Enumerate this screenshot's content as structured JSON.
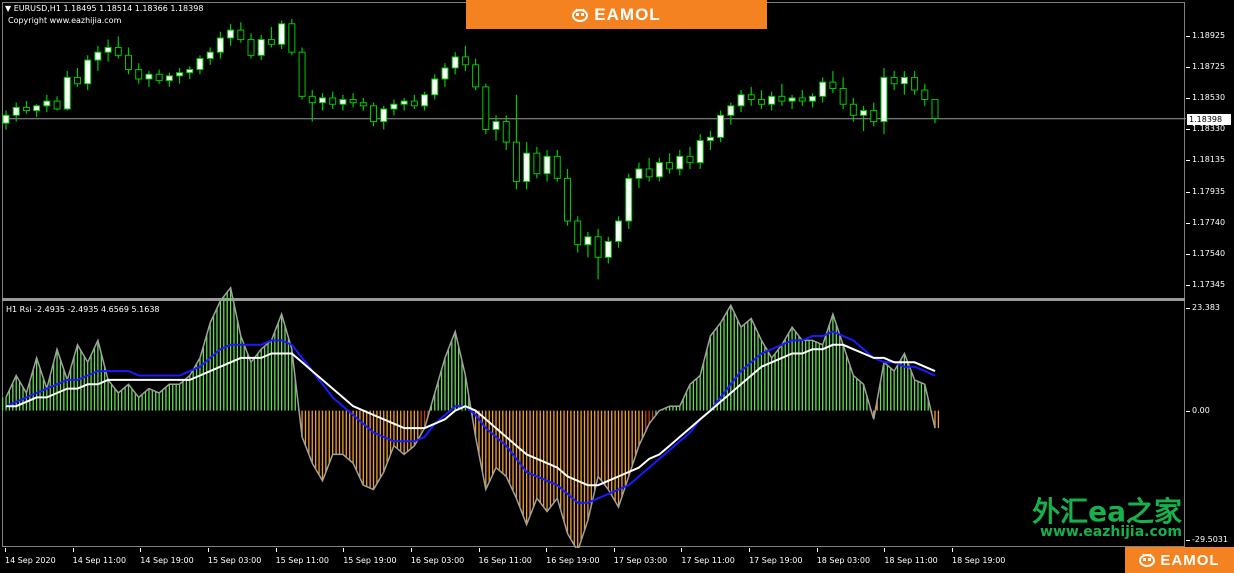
{
  "chart_window": {
    "symbol_header": "EURUSD,H1  1.18495 1.18514 1.18366 1.18398",
    "copyright": "Copyright www.eazhijia.com",
    "indicator_header": "H1 Rsi -2.4935 -2.4935 4.6569 5.1638"
  },
  "price_axis": {
    "labels": [
      "1.18925",
      "1.18725",
      "1.18530",
      "1.18330",
      "1.18135",
      "1.17935",
      "1.17740",
      "1.17540",
      "1.17345"
    ],
    "current_price": "1.18398"
  },
  "indicator_axis": {
    "labels": [
      "23.383",
      "0.00",
      "-29.5031"
    ]
  },
  "time_axis": {
    "labels": [
      "14 Sep 2020",
      "14 Sep 11:00",
      "14 Sep 19:00",
      "15 Sep 03:00",
      "15 Sep 11:00",
      "15 Sep 19:00",
      "16 Sep 03:00",
      "16 Sep 11:00",
      "16 Sep 19:00",
      "17 Sep 03:00",
      "17 Sep 11:00",
      "17 Sep 19:00",
      "18 Sep 03:00",
      "18 Sep 11:00",
      "18 Sep 19:00"
    ]
  },
  "branding": {
    "top_banner": "EAMOL",
    "bottom_banner": "EAMOL",
    "watermark_cn": "外汇ea之家",
    "watermark_url": "www.eazhijia.com"
  },
  "colors": {
    "bull_candle": "#ffffff",
    "bear_candle": "#000000",
    "candle_wick": "#00c800",
    "hist_positive": "#66dd55",
    "hist_negative": "#f0a030",
    "hist_negative_dark": "#b84010",
    "rsi_line": "#a0a0a0",
    "signal_fast": "#1a1aff",
    "signal_slow": "#ffffff",
    "brand": "#f58220",
    "watermark": "#18b04a"
  },
  "chart_data": [
    {
      "type": "candlestick",
      "title": "EURUSD,H1",
      "ylim": [
        1.173,
        1.191
      ],
      "candles": [
        [
          1.1837,
          1.1845,
          1.1833,
          1.1842
        ],
        [
          1.1842,
          1.185,
          1.1838,
          1.1847
        ],
        [
          1.1847,
          1.1851,
          1.1843,
          1.1845
        ],
        [
          1.1845,
          1.1849,
          1.1841,
          1.1848
        ],
        [
          1.1848,
          1.1855,
          1.1844,
          1.1851
        ],
        [
          1.1851,
          1.1854,
          1.1845,
          1.1846
        ],
        [
          1.1846,
          1.187,
          1.1845,
          1.1866
        ],
        [
          1.1866,
          1.1872,
          1.186,
          1.1862
        ],
        [
          1.1862,
          1.188,
          1.1858,
          1.1877
        ],
        [
          1.1877,
          1.1886,
          1.187,
          1.1882
        ],
        [
          1.1882,
          1.189,
          1.1876,
          1.1885
        ],
        [
          1.1885,
          1.1892,
          1.1878,
          1.188
        ],
        [
          1.188,
          1.1885,
          1.1868,
          1.1871
        ],
        [
          1.1871,
          1.1875,
          1.1862,
          1.1865
        ],
        [
          1.1865,
          1.187,
          1.186,
          1.1868
        ],
        [
          1.1868,
          1.1871,
          1.1862,
          1.1864
        ],
        [
          1.1864,
          1.1869,
          1.186,
          1.1867
        ],
        [
          1.1867,
          1.1872,
          1.1862,
          1.1869
        ],
        [
          1.1869,
          1.1873,
          1.1865,
          1.1871
        ],
        [
          1.1871,
          1.188,
          1.1868,
          1.1878
        ],
        [
          1.1878,
          1.1885,
          1.1874,
          1.1882
        ],
        [
          1.1882,
          1.1895,
          1.1878,
          1.1891
        ],
        [
          1.1891,
          1.19,
          1.1886,
          1.1896
        ],
        [
          1.1896,
          1.1901,
          1.1888,
          1.189
        ],
        [
          1.189,
          1.1894,
          1.1878,
          1.188
        ],
        [
          1.188,
          1.1893,
          1.1877,
          1.189
        ],
        [
          1.189,
          1.1898,
          1.1885,
          1.1887
        ],
        [
          1.1887,
          1.1902,
          1.1884,
          1.19
        ],
        [
          1.19,
          1.1903,
          1.188,
          1.1882
        ],
        [
          1.1882,
          1.1885,
          1.1852,
          1.1854
        ],
        [
          1.1854,
          1.1858,
          1.1838,
          1.185
        ],
        [
          1.185,
          1.1856,
          1.1845,
          1.1853
        ],
        [
          1.1853,
          1.1857,
          1.1846,
          1.1849
        ],
        [
          1.1849,
          1.1855,
          1.1845,
          1.1852
        ],
        [
          1.1852,
          1.1856,
          1.1847,
          1.185
        ],
        [
          1.185,
          1.1853,
          1.1845,
          1.1848
        ],
        [
          1.1848,
          1.185,
          1.1835,
          1.1838
        ],
        [
          1.1838,
          1.1848,
          1.1833,
          1.1846
        ],
        [
          1.1846,
          1.1852,
          1.1842,
          1.1849
        ],
        [
          1.1849,
          1.1853,
          1.1845,
          1.1851
        ],
        [
          1.1851,
          1.1855,
          1.1846,
          1.1848
        ],
        [
          1.1848,
          1.1857,
          1.1845,
          1.1855
        ],
        [
          1.1855,
          1.1868,
          1.1852,
          1.1865
        ],
        [
          1.1865,
          1.1875,
          1.186,
          1.1872
        ],
        [
          1.1872,
          1.1882,
          1.1868,
          1.1879
        ],
        [
          1.1879,
          1.1886,
          1.187,
          1.1874
        ],
        [
          1.1874,
          1.1878,
          1.1858,
          1.186
        ],
        [
          1.186,
          1.1862,
          1.183,
          1.1833
        ],
        [
          1.1833,
          1.1842,
          1.1826,
          1.1838
        ],
        [
          1.1838,
          1.1842,
          1.182,
          1.1825
        ],
        [
          1.1825,
          1.1855,
          1.1795,
          1.18
        ],
        [
          1.18,
          1.1825,
          1.1795,
          1.1818
        ],
        [
          1.1818,
          1.1822,
          1.1802,
          1.1805
        ],
        [
          1.1805,
          1.182,
          1.18,
          1.1816
        ],
        [
          1.1816,
          1.182,
          1.18,
          1.1802
        ],
        [
          1.1802,
          1.1808,
          1.1772,
          1.1775
        ],
        [
          1.1775,
          1.1778,
          1.1755,
          1.176
        ],
        [
          1.176,
          1.1768,
          1.1752,
          1.1765
        ],
        [
          1.1765,
          1.177,
          1.1738,
          1.1752
        ],
        [
          1.1752,
          1.1765,
          1.1748,
          1.1762
        ],
        [
          1.1762,
          1.1778,
          1.1758,
          1.1775
        ],
        [
          1.1775,
          1.1805,
          1.177,
          1.1802
        ],
        [
          1.1802,
          1.1812,
          1.1796,
          1.1808
        ],
        [
          1.1808,
          1.1815,
          1.18,
          1.1803
        ],
        [
          1.1803,
          1.1815,
          1.18,
          1.1812
        ],
        [
          1.1812,
          1.1818,
          1.1805,
          1.1808
        ],
        [
          1.1808,
          1.182,
          1.1804,
          1.1816
        ],
        [
          1.1816,
          1.1822,
          1.1808,
          1.1812
        ],
        [
          1.1812,
          1.183,
          1.1808,
          1.1826
        ],
        [
          1.1826,
          1.1832,
          1.182,
          1.1828
        ],
        [
          1.1828,
          1.1845,
          1.1825,
          1.1842
        ],
        [
          1.1842,
          1.185,
          1.1836,
          1.1848
        ],
        [
          1.1848,
          1.1858,
          1.1844,
          1.1855
        ],
        [
          1.1855,
          1.186,
          1.1848,
          1.1852
        ],
        [
          1.1852,
          1.1858,
          1.1846,
          1.1849
        ],
        [
          1.1849,
          1.1857,
          1.1845,
          1.1854
        ],
        [
          1.1854,
          1.1862,
          1.1848,
          1.1851
        ],
        [
          1.1851,
          1.1855,
          1.1846,
          1.1853
        ],
        [
          1.1853,
          1.1858,
          1.1848,
          1.1851
        ],
        [
          1.1851,
          1.1856,
          1.1847,
          1.1854
        ],
        [
          1.1854,
          1.1866,
          1.185,
          1.1863
        ],
        [
          1.1863,
          1.187,
          1.1856,
          1.1859
        ],
        [
          1.1859,
          1.1866,
          1.1846,
          1.1849
        ],
        [
          1.1849,
          1.1853,
          1.1838,
          1.1842
        ],
        [
          1.1842,
          1.1848,
          1.1832,
          1.1845
        ],
        [
          1.1845,
          1.185,
          1.1835,
          1.1838
        ],
        [
          1.1838,
          1.1872,
          1.183,
          1.1866
        ],
        [
          1.1866,
          1.187,
          1.1858,
          1.1862
        ],
        [
          1.1862,
          1.187,
          1.1855,
          1.1866
        ],
        [
          1.1866,
          1.187,
          1.1855,
          1.1858
        ],
        [
          1.1858,
          1.1862,
          1.1848,
          1.1852
        ],
        [
          1.1852,
          1.1851,
          1.1837,
          1.184
        ]
      ]
    },
    {
      "type": "bar",
      "title": "H1 Rsi",
      "ylim": [
        -29.5031,
        23.383
      ],
      "series": [
        {
          "values": [
            3,
            8,
            4,
            12,
            5,
            14,
            7,
            15,
            11,
            16,
            7,
            4,
            6,
            3,
            5,
            4,
            6,
            6,
            8,
            12,
            20,
            25,
            28,
            17,
            11,
            14,
            16,
            22,
            14,
            -6,
            -12,
            -16,
            -10,
            -10,
            -12,
            -17,
            -18,
            -14,
            -8,
            -10,
            -8,
            -4,
            4,
            12,
            18,
            8,
            -6,
            -18,
            -13,
            -15,
            -20,
            -26,
            -20,
            -23,
            -20,
            -28,
            -32,
            -25,
            -15,
            -18,
            -22,
            -15,
            -8,
            -3,
            0,
            1,
            1,
            6,
            8,
            17,
            20,
            24,
            19,
            21,
            16,
            12,
            15,
            19,
            16,
            16,
            15,
            22,
            15,
            8,
            6,
            -2,
            11,
            9,
            13,
            7,
            6,
            -4
          ]
        },
        {
          "values": [
            1,
            2,
            3,
            4,
            5,
            6,
            7,
            7,
            8,
            9,
            9,
            9,
            9,
            8,
            8,
            8,
            8,
            8,
            9,
            10,
            12,
            14,
            15,
            15,
            15,
            15,
            16,
            16,
            15,
            12,
            9,
            6,
            3,
            1,
            -1,
            -3,
            -5,
            -6,
            -7,
            -7,
            -7,
            -6,
            -3,
            -1,
            1,
            1,
            -1,
            -4,
            -6,
            -8,
            -11,
            -14,
            -15,
            -16,
            -17,
            -19,
            -21,
            -21,
            -20,
            -19,
            -18,
            -17,
            -15,
            -13,
            -11,
            -9,
            -7,
            -5,
            -2,
            0,
            3,
            6,
            9,
            11,
            13,
            14,
            15,
            16,
            16,
            17,
            17,
            18,
            17,
            16,
            14,
            12,
            11,
            11,
            10,
            10,
            9,
            8
          ]
        },
        {
          "values": [
            1,
            1,
            2,
            3,
            3,
            4,
            5,
            5,
            6,
            6,
            7,
            7,
            7,
            7,
            7,
            7,
            7,
            7,
            7,
            8,
            9,
            10,
            11,
            12,
            12,
            12,
            13,
            13,
            13,
            11,
            9,
            7,
            5,
            3,
            1,
            0,
            -1,
            -2,
            -3,
            -4,
            -4,
            -4,
            -3,
            -2,
            0,
            1,
            0,
            -2,
            -4,
            -6,
            -8,
            -10,
            -11,
            -12,
            -13,
            -15,
            -16,
            -17,
            -17,
            -16,
            -15,
            -14,
            -13,
            -11,
            -10,
            -8,
            -6,
            -4,
            -2,
            0,
            2,
            4,
            6,
            8,
            10,
            11,
            12,
            13,
            13,
            14,
            14,
            15,
            15,
            14,
            13,
            12,
            12,
            11,
            11,
            11,
            10,
            9
          ]
        }
      ]
    }
  ]
}
